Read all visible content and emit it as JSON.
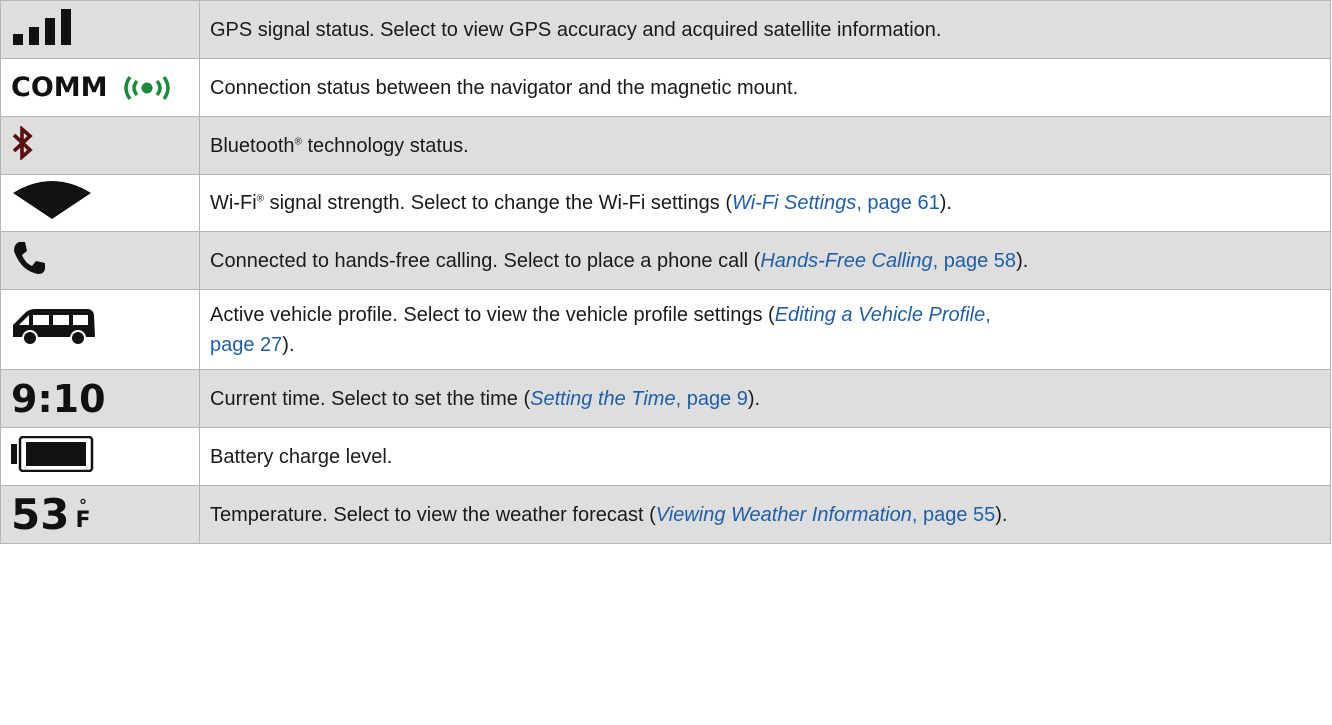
{
  "rows": [
    {
      "icon": "signal-bars-icon",
      "text": [
        {
          "t": "GPS signal status. Select to view GPS accuracy and acquired satellite information."
        }
      ]
    },
    {
      "icon": "comm-status-icon",
      "icon_label": "COMM",
      "icon_color": "#1e8a3c",
      "text": [
        {
          "t": "Connection status between the navigator and the magnetic mount."
        }
      ]
    },
    {
      "icon": "bluetooth-icon",
      "icon_color": "#5a0f0f",
      "text": [
        {
          "t": "Bluetooth"
        },
        {
          "sup": "®"
        },
        {
          "t": " technology status."
        }
      ]
    },
    {
      "icon": "wifi-icon",
      "text": [
        {
          "t": "Wi-Fi"
        },
        {
          "sup": "®"
        },
        {
          "t": " signal strength. Select to change the Wi-Fi settings ("
        },
        {
          "link_i": "Wi-Fi Settings",
          "link": ", page 61"
        },
        {
          "t": ")."
        }
      ]
    },
    {
      "icon": "phone-icon",
      "text": [
        {
          "t": "Connected to hands-free calling. Select to place a phone call ("
        },
        {
          "link_i": "Hands-Free Calling",
          "link": ", page 58"
        },
        {
          "t": ")."
        }
      ]
    },
    {
      "icon": "vehicle-icon",
      "text": [
        {
          "t": "Active vehicle profile. Select to view the vehicle profile settings ("
        },
        {
          "link_i": "Editing a Vehicle Profile",
          "link": ","
        },
        {
          "br": true
        },
        {
          "link": "page 27"
        },
        {
          "t": ")."
        }
      ]
    },
    {
      "icon": "time-display",
      "icon_label": "9:10",
      "text": [
        {
          "t": "Current time. Select to set the time ("
        },
        {
          "link_i": "Setting the Time",
          "link": ", page 9"
        },
        {
          "t": ")."
        }
      ]
    },
    {
      "icon": "battery-icon",
      "battery_level": 1.0,
      "text": [
        {
          "t": "Battery charge level."
        }
      ]
    },
    {
      "icon": "temperature-display",
      "icon_label": "53",
      "icon_unit_deg": "°",
      "icon_unit": "F",
      "text": [
        {
          "t": "Temperature. Select to view the weather forecast ("
        },
        {
          "link_i": "Viewing Weather Information",
          "link": ", page 55"
        },
        {
          "t": ")."
        }
      ]
    }
  ]
}
